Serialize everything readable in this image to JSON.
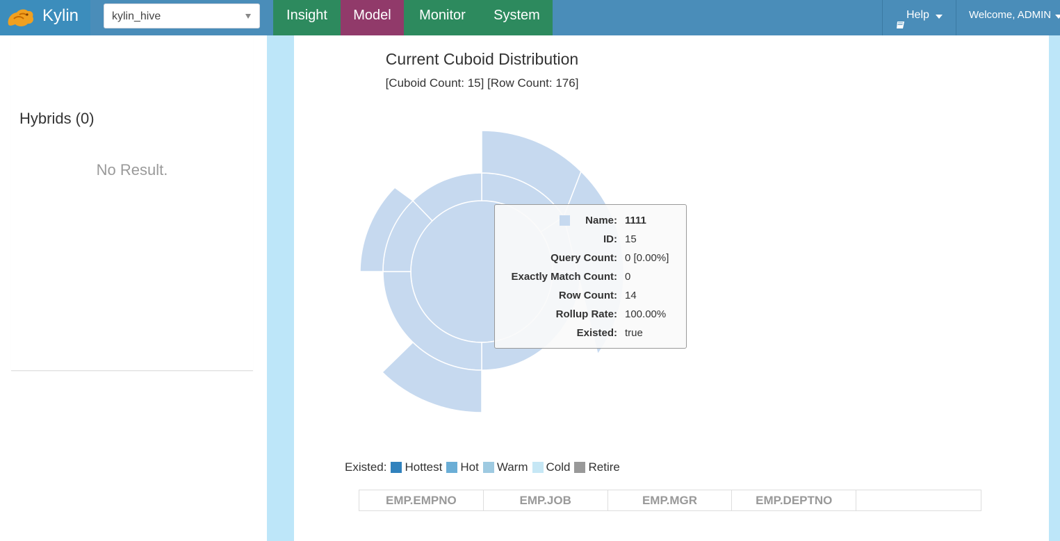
{
  "navbar": {
    "brand": "Kylin",
    "project_select": {
      "value": "kylin_hive"
    },
    "menu": [
      {
        "label": "Insight",
        "active": false
      },
      {
        "label": "Model",
        "active": true
      },
      {
        "label": "Monitor",
        "active": false
      },
      {
        "label": "System",
        "active": false
      }
    ],
    "help_label": "Help",
    "welcome_label": "Welcome, ADMIN",
    "colors": {
      "navbar": "#4a8db9",
      "menu": "#2d8a5e",
      "active": "#913a6a"
    }
  },
  "sidebar": {
    "hybrids_title": "Hybrids (0)",
    "empty_text": "No Result."
  },
  "main": {
    "title": "Current Cuboid Distribution",
    "subtitle": "[Cuboid Count: 15] [Row Count: 176]",
    "tooltip": {
      "rows": [
        {
          "key": "Name:",
          "value": "1111"
        },
        {
          "key": "ID:",
          "value": "15"
        },
        {
          "key": "Query Count:",
          "value": "0 [0.00%]"
        },
        {
          "key": "Exactly Match Count:",
          "value": "0"
        },
        {
          "key": "Row Count:",
          "value": "14"
        },
        {
          "key": "Rollup Rate:",
          "value": "100.00%"
        },
        {
          "key": "Existed:",
          "value": "true"
        }
      ]
    },
    "legend": {
      "prefix": "Existed:",
      "items": [
        {
          "label": "Hottest",
          "color": "#3182bd"
        },
        {
          "label": "Hot",
          "color": "#6baed6"
        },
        {
          "label": "Warm",
          "color": "#9ecae1"
        },
        {
          "label": "Cold",
          "color": "#c6e7f5"
        },
        {
          "label": "Retire",
          "color": "#999999"
        }
      ]
    },
    "dimension_columns": [
      "EMP.EMPNO",
      "EMP.JOB",
      "EMP.MGR",
      "EMP.DEPTNO",
      ""
    ]
  }
}
